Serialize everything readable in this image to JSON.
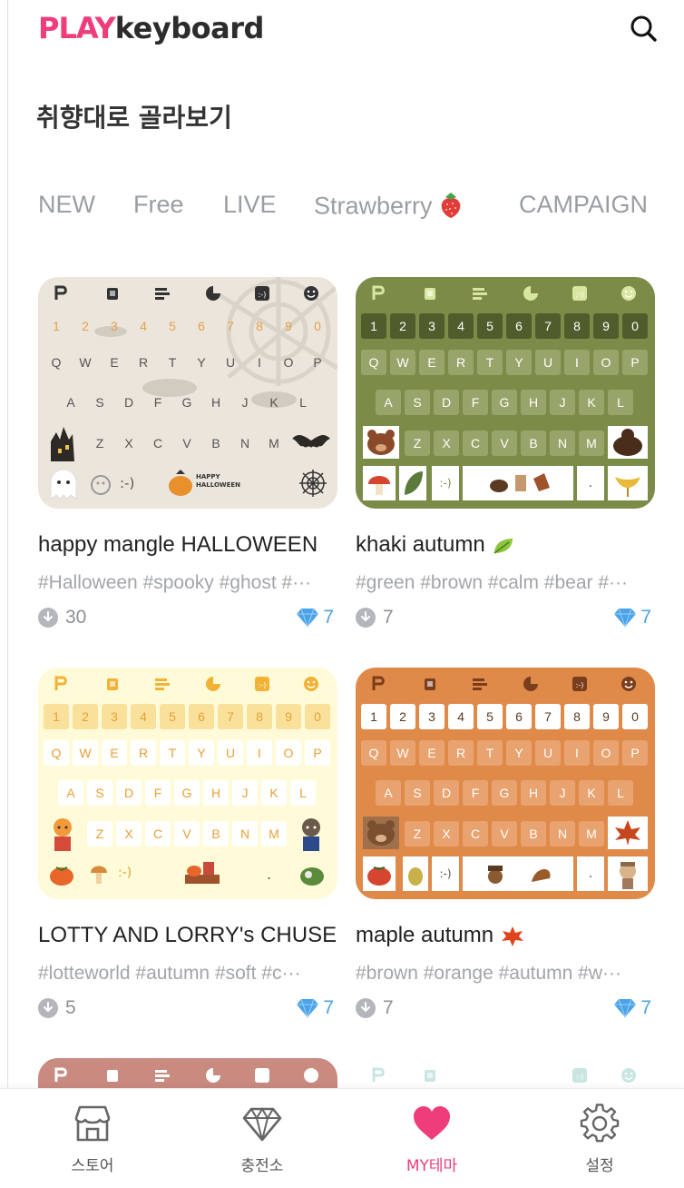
{
  "header": {
    "logo_play": "PLAY",
    "logo_keyboard": "keyboard",
    "search_icon": "search-icon"
  },
  "section_title": "취향대로 골라보기",
  "tabs": [
    {
      "label": "NEW"
    },
    {
      "label": "Free"
    },
    {
      "label": "LIVE"
    },
    {
      "label": "Strawberry"
    },
    {
      "label": "CAMPAIGN"
    }
  ],
  "themes": [
    {
      "title": "happy mangle HALLOWEEN",
      "tags": "#Halloween #spooky #ghost #···",
      "downloads": "30",
      "price": "7",
      "badge_text": "HAPPY HALLOWEEN",
      "emoticon": ":-)",
      "colors": {
        "bg": "#ebe5dc",
        "key": "#ebe5dc",
        "text": "#555555",
        "num": "#e8a04a",
        "toolbar": "#333333"
      }
    },
    {
      "title": "khaki autumn",
      "tags": "#green #brown #calm #bear #···",
      "downloads": "7",
      "price": "7",
      "emoticon": ":-)",
      "colors": {
        "bg": "#7b8c49",
        "key": "#97a56a",
        "num_key": "#4f5d2c",
        "text": "#ffffff",
        "toolbar": "#d9e6a0"
      }
    },
    {
      "title": "LOTTY AND LORRY's CHUSE",
      "tags": "#lotteworld #autumn #soft #c···",
      "downloads": "5",
      "price": "7",
      "emoticon": ":-)",
      "colors": {
        "bg": "#fffbd8",
        "key": "#ffffff",
        "num_key": "#f9e19c",
        "text": "#e8a033",
        "toolbar": "#f2b236"
      }
    },
    {
      "title": "maple autumn",
      "tags": "#brown #orange #autumn #w···",
      "downloads": "7",
      "price": "7",
      "emoticon": ":-)",
      "colors": {
        "bg": "#e08a4a",
        "key": "#e9a370",
        "num_key": "#ffffff",
        "text": "#ffffff",
        "toolbar": "#7a3e1c"
      }
    }
  ],
  "keyboard": {
    "numbers": [
      "1",
      "2",
      "3",
      "4",
      "5",
      "6",
      "7",
      "8",
      "9",
      "0"
    ],
    "row_q": [
      "Q",
      "W",
      "E",
      "R",
      "T",
      "Y",
      "U",
      "I",
      "O",
      "P"
    ],
    "row_a": [
      "A",
      "S",
      "D",
      "F",
      "G",
      "H",
      "J",
      "K",
      "L"
    ],
    "row_z": [
      "Z",
      "X",
      "C",
      "V",
      "B",
      "N",
      "M"
    ]
  },
  "bottom_nav": [
    {
      "label": "스토어",
      "icon": "store-icon"
    },
    {
      "label": "충전소",
      "icon": "diamond-icon"
    },
    {
      "label": "MY테마",
      "icon": "heart-icon",
      "active": true
    },
    {
      "label": "설정",
      "icon": "gear-icon"
    }
  ],
  "colors": {
    "brand_pink": "#ef3c7b",
    "price_blue": "#4aa3e8",
    "tab_gray": "#9a9ea4"
  }
}
